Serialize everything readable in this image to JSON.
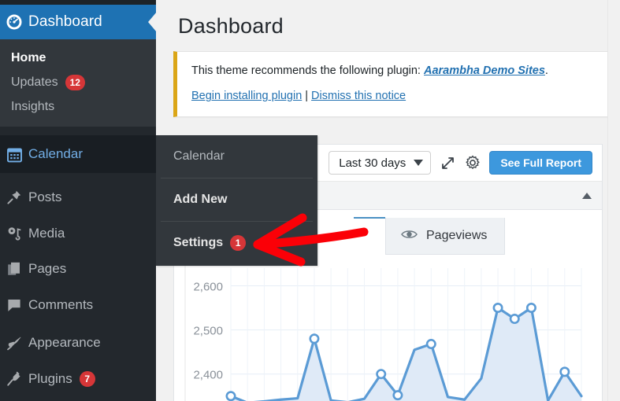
{
  "sidebar": {
    "header": {
      "label": "Dashboard",
      "icon": "dashboard-gauge-icon",
      "bg": "#1e72b3"
    },
    "submenu": [
      {
        "label": "Home",
        "current": true
      },
      {
        "label": "Updates",
        "badge": "12"
      },
      {
        "label": "Insights"
      }
    ],
    "items": [
      {
        "label": "Calendar",
        "icon": "calendar-icon",
        "hovered": true
      },
      {
        "label": "Posts",
        "icon": "pin-icon"
      },
      {
        "label": "Media",
        "icon": "media-icon"
      },
      {
        "label": "Pages",
        "icon": "pages-icon"
      },
      {
        "label": "Comments",
        "icon": "comment-bubble-icon"
      },
      {
        "label": "Appearance",
        "icon": "paintbrush-icon"
      },
      {
        "label": "Plugins",
        "icon": "plug-icon",
        "badge": "7"
      }
    ]
  },
  "flyout": {
    "items": [
      {
        "label": "Calendar"
      },
      {
        "label": "Add New"
      },
      {
        "label": "Settings",
        "badge": "1"
      }
    ]
  },
  "main": {
    "page_title": "Dashboard",
    "notice": {
      "text_before": "This theme recommends the following plugin: ",
      "plugin_link": "Aarambha Demo Sites",
      "text_after": ".",
      "action_install": "Begin installing plugin",
      "separator": "|",
      "action_dismiss": "Dismiss this notice",
      "accent_color": "#dba617"
    },
    "panel": {
      "date_range": "Last 30 days",
      "expand_icon": "expand-arrows-icon",
      "settings_icon": "gear-icon",
      "report_button": "See Full Report",
      "collapse_icon": "caret-up-icon",
      "tab": {
        "label": "Pageviews",
        "icon": "eye-icon"
      }
    }
  },
  "annotation": {
    "type": "arrow",
    "color": "#fb0007",
    "direction": "left"
  },
  "chart_data": {
    "type": "area",
    "title": "Pageviews",
    "xlabel": "",
    "ylabel": "",
    "grid": true,
    "legend": "none",
    "ytick_labels": [
      "2,600",
      "2,500",
      "2,400"
    ],
    "ytick_values": [
      2600,
      2500,
      2400
    ],
    "ylim": [
      2330,
      2640
    ],
    "series": [
      {
        "name": "Pageviews",
        "color": "#5b9bd5",
        "fill": "#dfeaf7",
        "values": [
          2350,
          2335,
          2338,
          2342,
          2345,
          2480,
          2340,
          2336,
          2344,
          2400,
          2352,
          2455,
          2468,
          2348,
          2342,
          2390,
          2550,
          2525,
          2550,
          2340,
          2405,
          2350
        ]
      }
    ]
  }
}
